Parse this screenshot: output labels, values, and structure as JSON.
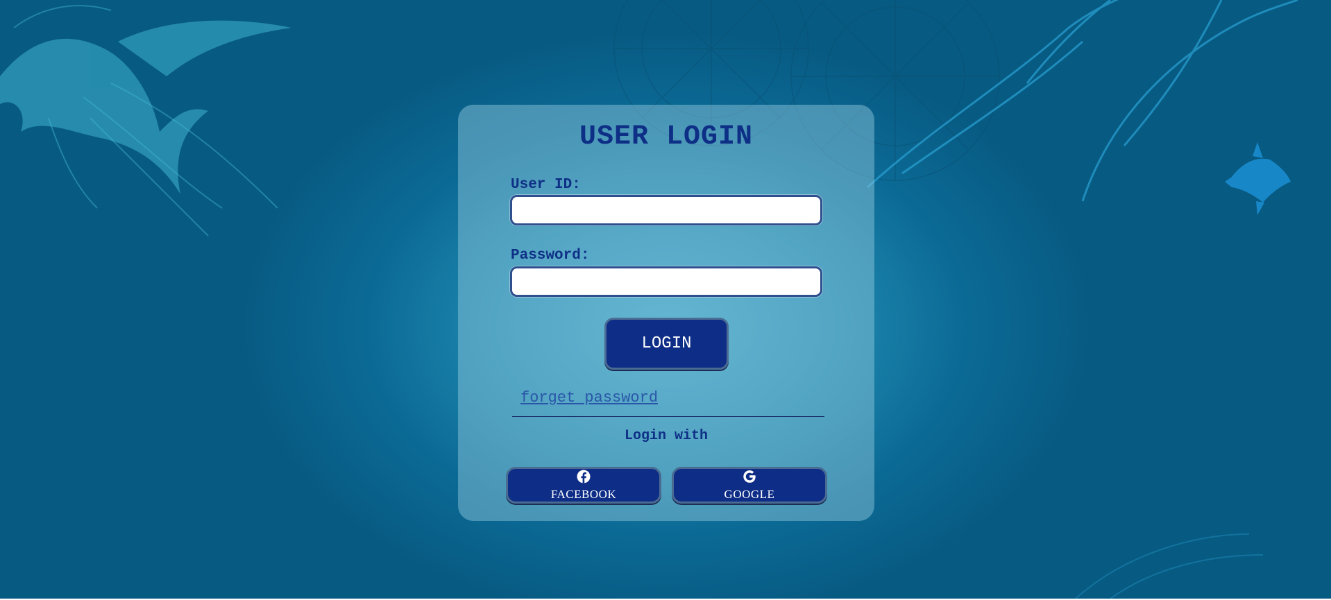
{
  "login_card": {
    "title": "USER LOGIN",
    "user_id_label": "User ID:",
    "user_id_value": "",
    "password_label": "Password:",
    "password_value": "",
    "login_button": "LOGIN",
    "forget_password_link": "forget password",
    "login_with_label": "Login with",
    "social": {
      "facebook": {
        "label": "FACEBOOK",
        "icon": "facebook-icon"
      },
      "google": {
        "label": "GOOGLE",
        "icon": "google-icon"
      }
    }
  },
  "colors": {
    "background": "#0b6a95",
    "card": "#96cde1",
    "primary": "#0d2d87",
    "title_text": "#0e2f86",
    "link": "#2a56a8",
    "input_border": "#2f4f8f"
  }
}
